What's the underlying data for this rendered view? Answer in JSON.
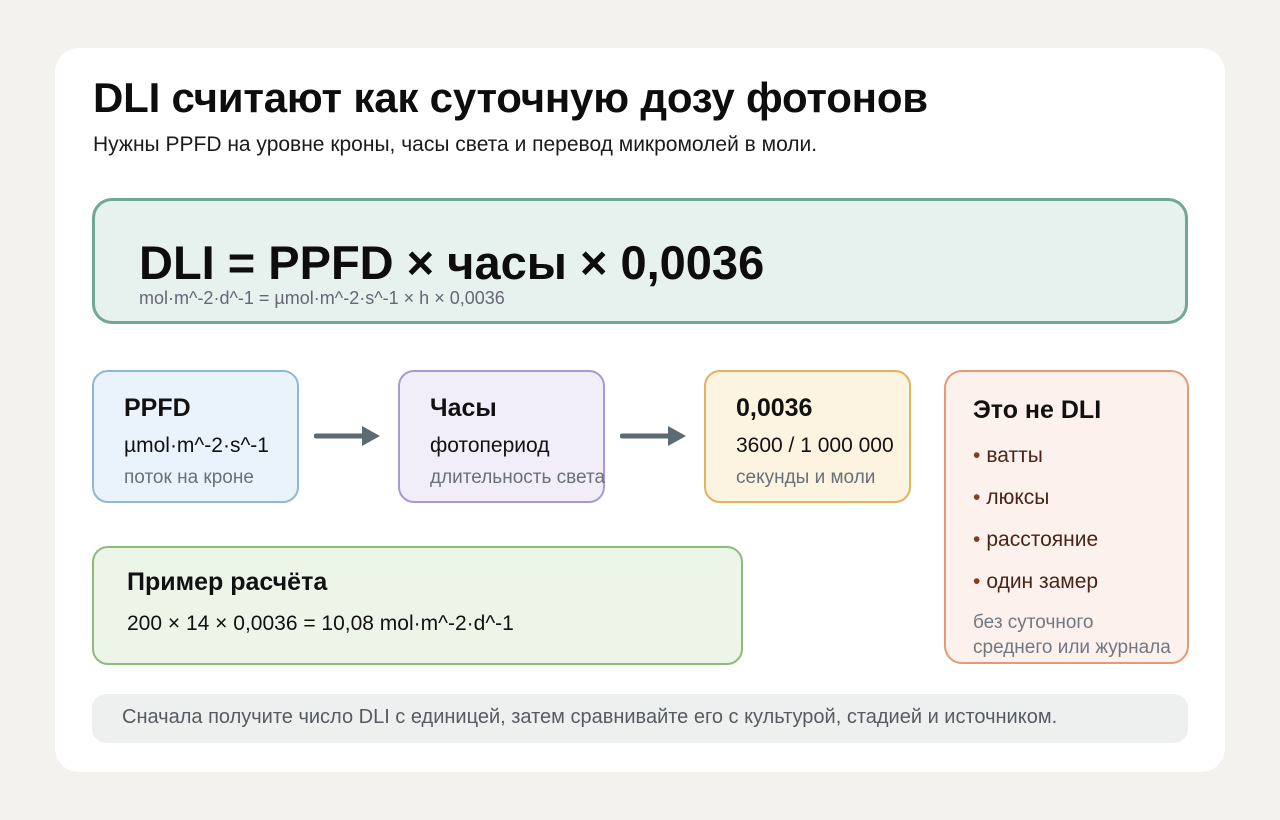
{
  "title": "DLI считают как суточную дозу фотонов",
  "subtitle": "Нужны PPFD на уровне кроны, часы света и перевод микромолей в моли.",
  "formula": {
    "main": "DLI = PPFD × часы × 0,0036",
    "units": "mol·m^-2·d^-1 = µmol·m^-2·s^-1 × h × 0,0036"
  },
  "steps": [
    {
      "heading": "PPFD",
      "main": "µmol·m^-2·s^-1",
      "sub": "поток на кроне"
    },
    {
      "heading": "Часы",
      "main": "фотопериод",
      "sub": "длительность света"
    },
    {
      "heading": "0,0036",
      "main": "3600 / 1 000 000",
      "sub": "секунды и моли"
    }
  ],
  "not_dli": {
    "heading": "Это не DLI",
    "bullet": "•",
    "items": [
      "ватты",
      "люксы",
      "расстояние",
      "один замер"
    ],
    "note_line1": "без суточного",
    "note_line2": "среднего или журнала"
  },
  "example": {
    "heading": "Пример расчёта",
    "calc": "200 × 14 × 0,0036 = 10,08 mol·m^-2·d^-1"
  },
  "footer": "Сначала получите число DLI с единицей, затем сравнивайте его с культурой, стадией и источником.",
  "colors": {
    "formula_border": "#6fa893",
    "ppfd_border": "#8fb8d4",
    "hours_border": "#a99bd0",
    "const_border": "#e2b35a",
    "not_dli_border": "#e39a78",
    "example_border": "#8cbc7c",
    "arrow": "#5b6b73"
  }
}
